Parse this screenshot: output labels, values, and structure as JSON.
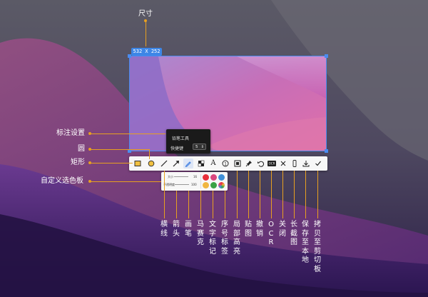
{
  "dimension_label": "532  X  252",
  "annotations": {
    "size": "尺寸",
    "annotation_settings": "标注设置",
    "circle": "圆",
    "rectangle": "矩形",
    "custom_palette": "自定义选色板"
  },
  "popup": {
    "title": "铅笔工具",
    "shortcut_label": "快捷键",
    "shortcut_value": "5"
  },
  "palette": {
    "size_label": "大小",
    "size_value": "16",
    "opacity_label": "不透明度",
    "opacity_value": "100",
    "colors": [
      "#e8303a",
      "#d9477f",
      "#3f8fd8",
      "#f0b640",
      "#3aa245",
      "#4a6fd8"
    ]
  },
  "tools": [
    {
      "name": "rectangle",
      "icon": "rectangle-icon"
    },
    {
      "name": "circle",
      "icon": "circle-icon"
    },
    {
      "name": "line",
      "icon": "line-icon",
      "label": "横线"
    },
    {
      "name": "arrow",
      "icon": "arrow-icon",
      "label": "箭头"
    },
    {
      "name": "pen",
      "icon": "pen-icon",
      "label": "画笔"
    },
    {
      "name": "mosaic",
      "icon": "mosaic-icon",
      "label": "马赛克"
    },
    {
      "name": "text",
      "icon": "text-icon",
      "label": "文字标记"
    },
    {
      "name": "number",
      "icon": "number-icon",
      "label": "序号标签"
    },
    {
      "name": "highlight",
      "icon": "highlight-icon",
      "label": "局部高亮"
    },
    {
      "name": "pin",
      "icon": "pin-icon",
      "label": "贴图"
    },
    {
      "name": "undo",
      "icon": "undo-icon",
      "label": "撤销"
    },
    {
      "name": "ocr",
      "icon": "ocr-icon",
      "label": "OCR"
    },
    {
      "name": "close",
      "icon": "close-icon",
      "label": "关闭"
    },
    {
      "name": "long-screenshot",
      "icon": "long-screenshot-icon",
      "label": "长截图"
    },
    {
      "name": "save",
      "icon": "download-icon",
      "label": "保存至本地"
    },
    {
      "name": "copy",
      "icon": "check-icon",
      "label": "拷贝至剪切板"
    }
  ]
}
